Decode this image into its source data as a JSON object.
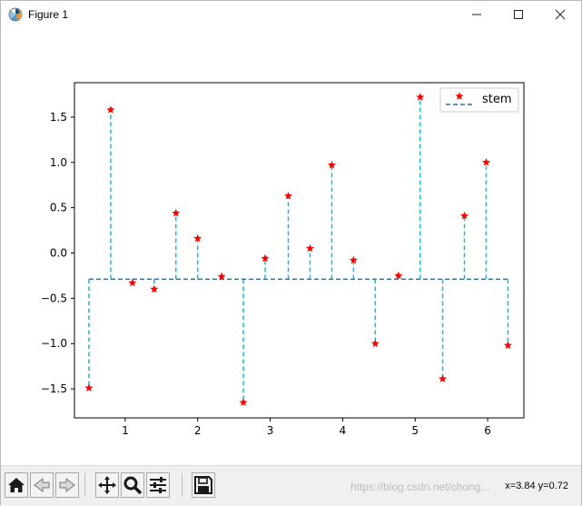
{
  "window": {
    "title": "Figure 1",
    "controls": {
      "minimize": "—",
      "maximize": "☐",
      "close": "✕"
    }
  },
  "toolbar": {
    "buttons": [
      "home-icon",
      "back-icon",
      "forward-icon",
      "pan-icon",
      "zoom-icon",
      "configure-subplots-icon",
      "save-icon"
    ],
    "status": "x=3.84 y=0.72",
    "watermark": "https://blog.csdn.net/chong..."
  },
  "chart_data": {
    "type": "stem",
    "title": "",
    "xlabel": "",
    "ylabel": "",
    "baseline": -0.29,
    "xlim": [
      0.3,
      6.5
    ],
    "ylim": [
      -1.82,
      1.88
    ],
    "xticks": [
      1,
      2,
      3,
      4,
      5,
      6
    ],
    "yticks": [
      -1.5,
      -1.0,
      -0.5,
      0.0,
      0.5,
      1.0,
      1.5
    ],
    "ytick_labels": [
      "−1.5",
      "−1.0",
      "−0.5",
      "0.0",
      "0.5",
      "1.0",
      "1.5"
    ],
    "legend": {
      "label": "stem",
      "position": "upper right"
    },
    "stem_color": "#17becf",
    "baseline_color": "#1f77b4",
    "marker_color": "#ff0000",
    "series": [
      {
        "name": "stem",
        "x": [
          0.5,
          0.8,
          1.1,
          1.4,
          1.7,
          2.0,
          2.33,
          2.63,
          2.93,
          3.25,
          3.55,
          3.85,
          4.15,
          4.45,
          4.77,
          5.07,
          5.38,
          5.68,
          5.98,
          6.28
        ],
        "y": [
          -1.49,
          1.58,
          -0.33,
          -0.4,
          0.44,
          0.16,
          -0.26,
          -1.65,
          -0.06,
          0.63,
          0.05,
          0.97,
          -0.08,
          -1.0,
          -0.25,
          1.72,
          -1.39,
          0.41,
          1.0,
          -1.02
        ]
      }
    ]
  }
}
